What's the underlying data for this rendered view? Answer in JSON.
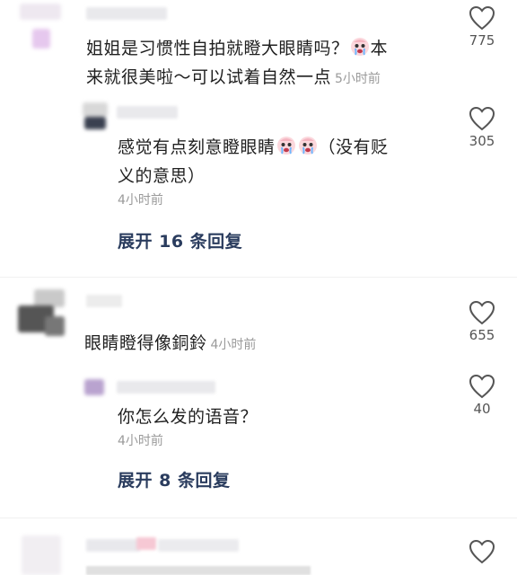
{
  "comments": [
    {
      "text_a": "姐姐是习惯性自拍就瞪大眼睛吗？",
      "text_b": "本",
      "text_c": "来就很美啦～可以试着自然一点",
      "time": "5小时前",
      "likes": "775",
      "emoji": "crying-face-icon"
    },
    {
      "text_a": "感觉有点刻意瞪眼睛",
      "text_b": "（没有贬",
      "text_c": "义的意思）",
      "time": "4小时前",
      "likes": "305",
      "emoji": "crying-face-icon"
    },
    {
      "expand": "展开 16 条回复"
    },
    {
      "text": "眼睛瞪得像銅鈴",
      "time": "4小时前",
      "likes": "655"
    },
    {
      "text": "你怎么发的语音？",
      "time": "4小时前",
      "likes": "40"
    },
    {
      "expand": "展开 8 条回复"
    }
  ],
  "colors": {
    "expand": "#2a3c5e",
    "meta": "#9a9a9a",
    "heart_outline": "#555555"
  },
  "icons": {
    "like": "heart-outline-icon"
  }
}
